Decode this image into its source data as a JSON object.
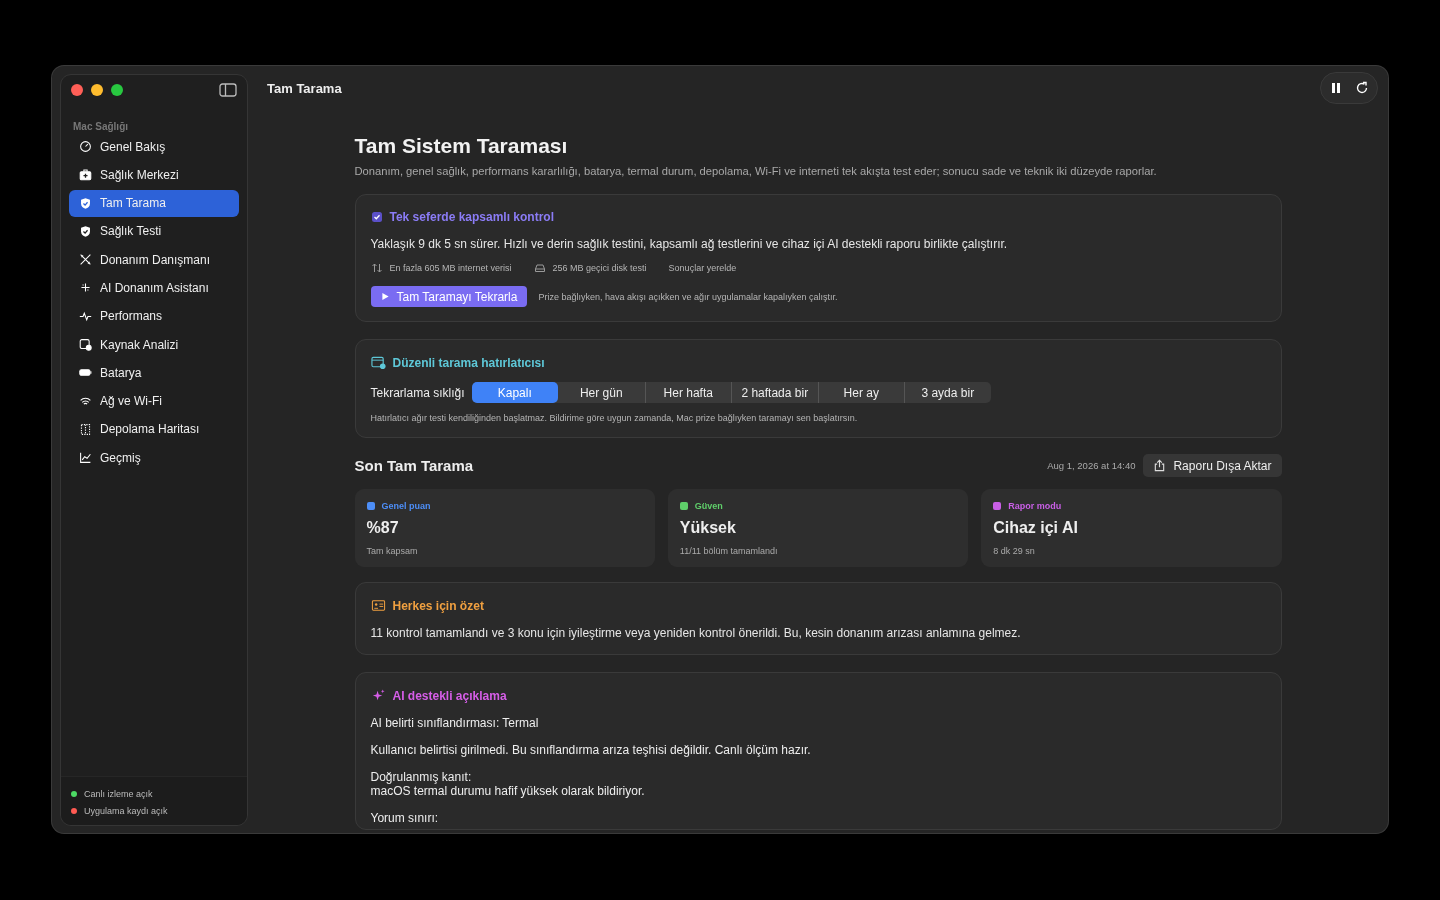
{
  "window": {
    "title": "Tam Tarama"
  },
  "sidebar": {
    "section": "Mac Sağlığı",
    "items": [
      {
        "label": "Genel Bakış",
        "selected": false
      },
      {
        "label": "Sağlık Merkezi",
        "selected": false
      },
      {
        "label": "Tam Tarama",
        "selected": true
      },
      {
        "label": "Sağlık Testi",
        "selected": false
      },
      {
        "label": "Donanım Danışmanı",
        "selected": false
      },
      {
        "label": "AI Donanım Asistanı",
        "selected": false
      },
      {
        "label": "Performans",
        "selected": false
      },
      {
        "label": "Kaynak Analizi",
        "selected": false
      },
      {
        "label": "Batarya",
        "selected": false
      },
      {
        "label": "Ağ ve Wi-Fi",
        "selected": false
      },
      {
        "label": "Depolama Haritası",
        "selected": false
      },
      {
        "label": "Geçmiş",
        "selected": false
      }
    ],
    "status": [
      {
        "label": "Canlı izleme açık",
        "color": "#4cd964"
      },
      {
        "label": "Uygulama kaydı açık",
        "color": "#ff5a52"
      }
    ]
  },
  "header": {
    "title": "Tam Sistem Taraması",
    "subtitle": "Donanım, genel sağlık, performans kararlılığı, batarya, termal durum, depolama, Wi-Fi ve interneti tek akışta test eder; sonucu sade ve teknik iki düzeyde raporlar."
  },
  "scan_card": {
    "title": "Tek seferde kapsamlı kontrol",
    "description": "Yaklaşık 9 dk 5 sn sürer. Hızlı ve derin sağlık testini, kapsamlı ağ testlerini ve cihaz içi AI destekli raporu birlikte çalıştırır.",
    "facts": [
      {
        "kind": "network",
        "text": "En fazla 605 MB internet verisi"
      },
      {
        "kind": "disk",
        "text": "256 MB geçici disk testi"
      },
      {
        "kind": "plain",
        "text": "Sonuçlar yerelde"
      }
    ],
    "button": "Tam Taramayı Tekrarla",
    "note": "Prize bağlıyken, hava akışı açıkken ve ağır uygulamalar kapalıyken çalıştır."
  },
  "reminder": {
    "title": "Düzenli tarama hatırlatıcısı",
    "label": "Tekrarlama sıklığı",
    "options": [
      {
        "label": "Kapalı",
        "selected": true
      },
      {
        "label": "Her gün",
        "selected": false
      },
      {
        "label": "Her hafta",
        "selected": false
      },
      {
        "label": "2 haftada bir",
        "selected": false
      },
      {
        "label": "Her ay",
        "selected": false
      },
      {
        "label": "3 ayda bir",
        "selected": false
      }
    ],
    "note": "Hatırlatıcı ağır testi kendiliğinden başlatmaz. Bildirime göre uygun zamanda, Mac prize bağlıyken taramayı sen başlatırsın."
  },
  "last_scan": {
    "title": "Son Tam Tarama",
    "date": "Aug 1, 2026 at 14:40",
    "export_button": "Raporu Dışa Aktar"
  },
  "metrics": [
    {
      "label": "Genel puan",
      "value": "%87",
      "caption": "Tam kapsam",
      "color": "#4d8ef7"
    },
    {
      "label": "Güven",
      "value": "Yüksek",
      "caption": "11/11 bölüm tamamlandı",
      "color": "#5fcf6a"
    },
    {
      "label": "Rapor modu",
      "value": "Cihaz içi AI",
      "caption": "8 dk 29 sn",
      "color": "#c95fe6"
    }
  ],
  "summary": {
    "title": "Herkes için özet",
    "text": "11 kontrol tamamlandı ve 3 konu için iyileştirme veya yeniden kontrol önerildi. Bu, kesin donanım arızası anlamına gelmez."
  },
  "ai": {
    "title": "AI destekli açıklama",
    "paragraphs": [
      [
        "AI belirti sınıflandırması: Termal"
      ],
      [
        "Kullanıcı belirtisi girilmedi. Bu sınıflandırma arıza teşhisi değildir. Canlı ölçüm hazır."
      ],
      [
        "Doğrulanmış kanıt:",
        "macOS termal durumu hafif yüksek olarak bildiriyor."
      ],
      [
        "Yorum sınırı:"
      ]
    ]
  }
}
